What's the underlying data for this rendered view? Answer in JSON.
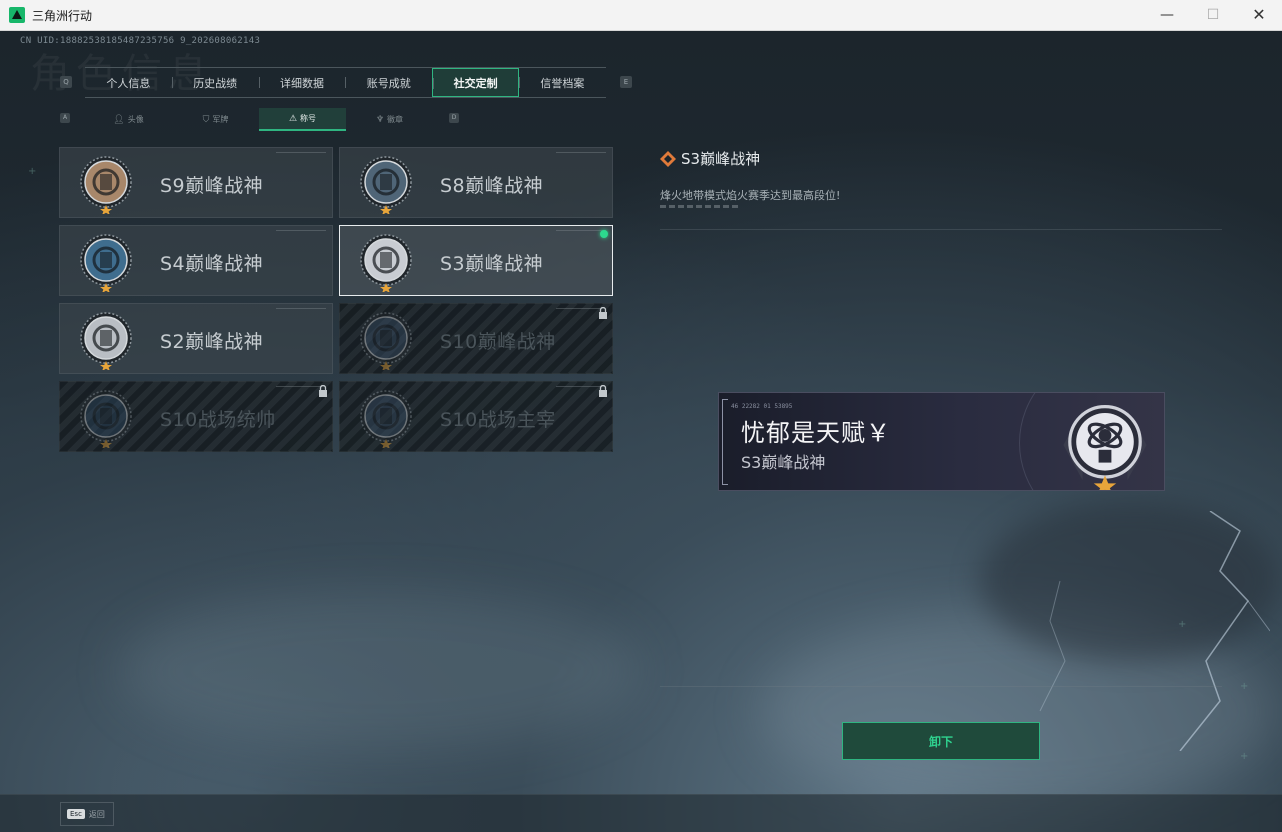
{
  "window": {
    "title": "三角洲行动",
    "minimize": "—",
    "maximize": "☐",
    "close": "✕"
  },
  "header": {
    "uid": "CN UID:18882538185487235756 9_202608062143",
    "bg_title": "角色信息"
  },
  "main_tabs": [
    {
      "label": "个人信息"
    },
    {
      "label": "历史战绩"
    },
    {
      "label": "详细数据"
    },
    {
      "label": "账号成就"
    },
    {
      "label": "社交定制",
      "active": true
    },
    {
      "label": "信誉档案"
    }
  ],
  "main_tab_keys": {
    "left": "Q",
    "right": "E"
  },
  "sub_tabs": [
    {
      "label": "头像",
      "icon": "person-icon"
    },
    {
      "label": "军牌",
      "icon": "dog-tag-icon"
    },
    {
      "label": "称号",
      "icon": "triangle-icon",
      "active": true
    },
    {
      "label": "徽章",
      "icon": "badge-icon"
    }
  ],
  "sub_tab_keys": {
    "left": "A",
    "right": "D"
  },
  "titles": [
    {
      "name": "S9巅峰战神",
      "locked": false,
      "selected": false,
      "medal_color": "#a8876a"
    },
    {
      "name": "S8巅峰战神",
      "locked": false,
      "selected": false,
      "medal_color": "#4f6577"
    },
    {
      "name": "S4巅峰战神",
      "locked": false,
      "selected": false,
      "medal_color": "#3f6d8e"
    },
    {
      "name": "S3巅峰战神",
      "locked": false,
      "selected": true,
      "equipped": true,
      "medal_color": "#c8ccd2"
    },
    {
      "name": "S2巅峰战神",
      "locked": false,
      "selected": false,
      "medal_color": "#b9bec4"
    },
    {
      "name": "S10巅峰战神",
      "locked": true,
      "selected": false,
      "medal_color": "#3a4f66"
    },
    {
      "name": "S10战场统帅",
      "locked": true,
      "selected": false,
      "medal_color": "#2e4760"
    },
    {
      "name": "S10战场主宰",
      "locked": true,
      "selected": false,
      "medal_color": "#3a4f66"
    }
  ],
  "detail": {
    "title": "S3巅峰战神",
    "description": "烽火地带模式焰火赛季达到最高段位!"
  },
  "banner": {
    "tech_text": "46 22282  01 53895",
    "player_name": "忧郁是天赋￥",
    "title": "S3巅峰战神"
  },
  "actions": {
    "unequip": "卸下"
  },
  "footer": {
    "esc_key": "Esc",
    "esc_label": "返回"
  },
  "colors": {
    "accent": "#2fb581",
    "equipped": "#2dd88e",
    "star": "#e8a53a"
  }
}
